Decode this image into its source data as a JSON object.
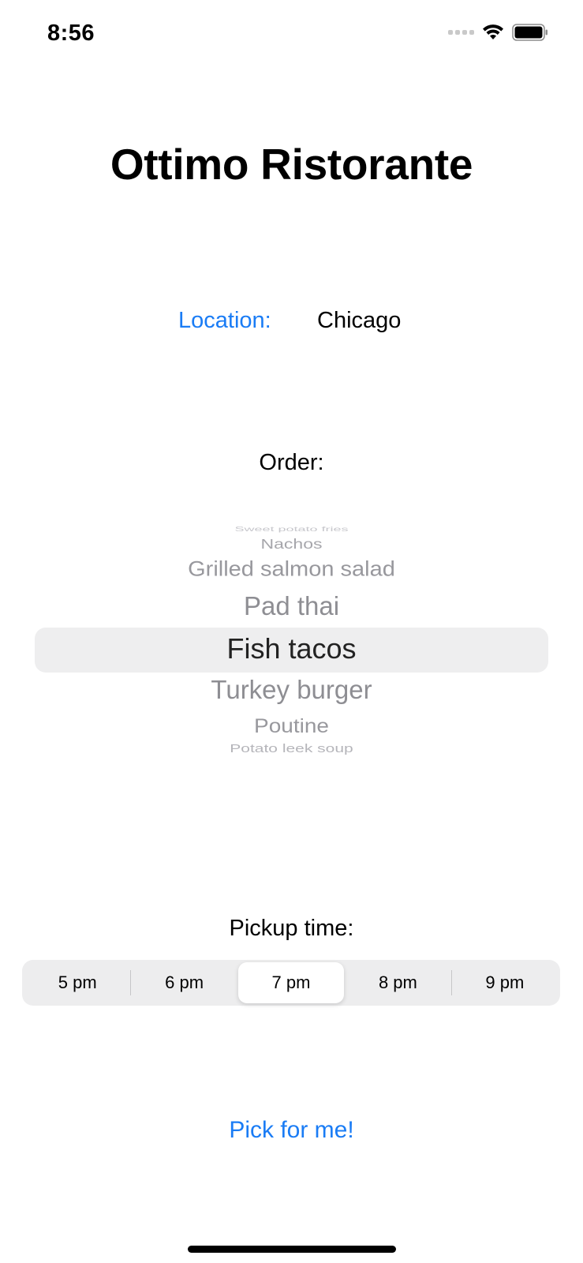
{
  "status_bar": {
    "time": "8:56",
    "icons": [
      "cellular-signal-icon",
      "wifi-icon",
      "battery-icon"
    ]
  },
  "title": "Ottimo Ristorante",
  "location": {
    "label": "Location:",
    "value": "Chicago"
  },
  "order": {
    "label": "Order:",
    "items_above": [
      "Sweet potato fries",
      "Nachos",
      "Grilled salmon salad",
      "Pad thai"
    ],
    "selected": "Fish tacos",
    "items_below": [
      "Turkey burger",
      "Poutine",
      "Potato leek soup"
    ]
  },
  "pickup": {
    "label": "Pickup time:",
    "options": [
      "5 pm",
      "6 pm",
      "7 pm",
      "8 pm",
      "9 pm"
    ],
    "selected": "7 pm"
  },
  "action": {
    "label": "Pick for me!"
  },
  "colors": {
    "accent": "#1a7cf5",
    "picker_highlight": "#eeeeef",
    "segment_background": "#ededee"
  }
}
